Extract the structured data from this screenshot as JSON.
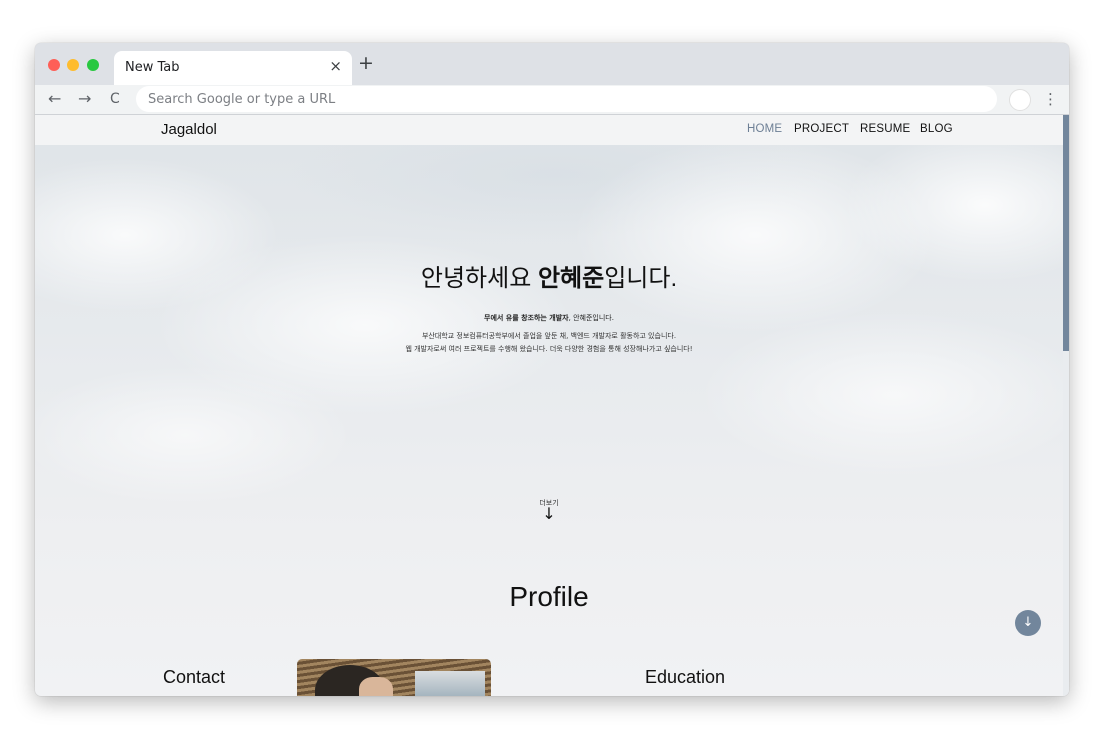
{
  "browser": {
    "tab_title": "New Tab",
    "tab_close": "×",
    "new_tab": "+",
    "back": "←",
    "forward": "→",
    "reload": "C",
    "omnibox_placeholder": "Search Google or type a URL",
    "menu": "⋮"
  },
  "site": {
    "brand": "Jagaldol",
    "nav": {
      "home": "HOME",
      "project": "PROJECT",
      "resume": "RESUME",
      "blog": "BLOG"
    },
    "accent_color": "#72869c",
    "hero": {
      "greeting": "안녕하세요 ",
      "name": "안혜준",
      "greeting_suffix": "입니다.",
      "tagline_bold": "무에서 유를 창조하는 개발자",
      "tagline_rest": ", 안혜준입니다.",
      "description_line1": "부산대학교 정보컴퓨터공학부에서 졸업을 앞둔 채, 백엔드 개발자로 활동하고 있습니다.",
      "description_line2": "웹 개발자로써 여러 프로젝트를 수행해 왔습니다. 더욱 다양한 경험을 통해 성장해나가고 싶습니다!",
      "more_label": "더보기",
      "more_arrow": "↓"
    },
    "profile": {
      "title": "Profile",
      "contact_title": "Contact",
      "education_title": "Education"
    },
    "scroll_down_button": "↓"
  }
}
